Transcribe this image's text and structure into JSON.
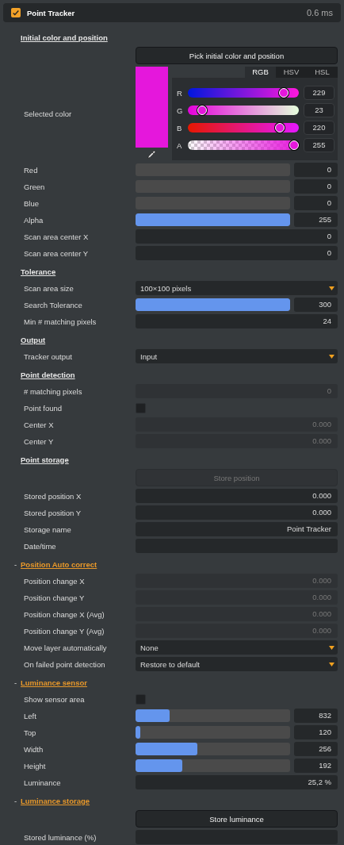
{
  "header": {
    "checked": true,
    "title": "Point Tracker",
    "time": "0.6 ms"
  },
  "sections": [
    {
      "title": "Initial color and position",
      "rows": [
        {
          "kind": "button",
          "text": "Pick initial color and position",
          "disabled": false
        },
        {
          "kind": "color",
          "label": "Selected color",
          "color": "#e517dc",
          "tabs": [
            {
              "label": "RGB",
              "selected": true
            },
            {
              "label": "HSV",
              "selected": false
            },
            {
              "label": "HSL",
              "selected": false
            }
          ],
          "channels": [
            {
              "name": "R",
              "level": 0.898,
              "value": "229"
            },
            {
              "name": "G",
              "level": 0.09,
              "value": "23"
            },
            {
              "name": "B",
              "level": 0.863,
              "value": "220"
            },
            {
              "name": "A",
              "level": 1,
              "value": "255"
            }
          ]
        },
        {
          "kind": "slider",
          "label": "Red",
          "level": 0,
          "value": "0"
        },
        {
          "kind": "slider",
          "label": "Green",
          "level": 0,
          "value": "0"
        },
        {
          "kind": "slider",
          "label": "Blue",
          "level": 0,
          "value": "0"
        },
        {
          "kind": "slider",
          "label": "Alpha",
          "level": 1,
          "value": "255"
        },
        {
          "kind": "number",
          "label": "Scan area center X",
          "value": "0",
          "disabled": false
        },
        {
          "kind": "number",
          "label": "Scan area center Y",
          "value": "0",
          "disabled": false
        }
      ]
    },
    {
      "title": "Tolerance",
      "rows": [
        {
          "kind": "dropdown",
          "label": "Scan area size",
          "value": "100×100 pixels"
        },
        {
          "kind": "slider",
          "label": "Search Tolerance",
          "level": 1,
          "value": "300"
        },
        {
          "kind": "number",
          "label": "Min # matching pixels",
          "value": "24",
          "disabled": false
        }
      ]
    },
    {
      "title": "Output",
      "rows": [
        {
          "kind": "dropdown",
          "label": "Tracker output",
          "value": "Input"
        }
      ]
    },
    {
      "title": "Point detection",
      "rows": [
        {
          "kind": "number",
          "label": "# matching pixels",
          "value": "0",
          "disabled": true
        },
        {
          "kind": "checkbox",
          "label": "Point found",
          "checked": false
        },
        {
          "kind": "number",
          "label": "Center X",
          "value": "0.000",
          "disabled": true
        },
        {
          "kind": "number",
          "label": "Center Y",
          "value": "0.000",
          "disabled": true
        }
      ]
    },
    {
      "title": "Point storage",
      "rows": [
        {
          "kind": "button",
          "text": "Store position",
          "disabled": true
        },
        {
          "kind": "number",
          "label": "Stored position X",
          "value": "0.000",
          "disabled": false
        },
        {
          "kind": "number",
          "label": "Stored position Y",
          "value": "0.000",
          "disabled": false
        },
        {
          "kind": "number",
          "label": "Storage name",
          "value": "Point Tracker",
          "disabled": false
        },
        {
          "kind": "number",
          "label": "Date/time"
        }
      ]
    },
    {
      "title": "Position Auto correct",
      "toggle": "-",
      "rows": [
        {
          "kind": "number",
          "label": "Position change X",
          "value": "0.000",
          "disabled": true
        },
        {
          "kind": "number",
          "label": "Position change Y",
          "value": "0.000",
          "disabled": true
        },
        {
          "kind": "number",
          "label": "Position change X (Avg)",
          "value": "0.000",
          "disabled": true
        },
        {
          "kind": "number",
          "label": "Position change Y (Avg)",
          "value": "0.000",
          "disabled": true
        },
        {
          "kind": "dropdown",
          "label": "Move layer automatically",
          "value": "None"
        },
        {
          "kind": "dropdown",
          "label": "On failed point detection",
          "value": "Restore to default"
        }
      ]
    },
    {
      "title": "Luminance sensor",
      "toggle": "-",
      "rows": [
        {
          "kind": "checkbox",
          "label": "Show sensor area",
          "checked": false
        },
        {
          "kind": "slider",
          "label": "Left",
          "level": 0.22,
          "value": "832"
        },
        {
          "kind": "slider",
          "label": "Top",
          "level": 0.03,
          "value": "120"
        },
        {
          "kind": "slider",
          "label": "Width",
          "level": 0.4,
          "value": "256"
        },
        {
          "kind": "slider",
          "label": "Height",
          "level": 0.3,
          "value": "192"
        },
        {
          "kind": "number",
          "label": "Luminance",
          "value": "25,2 %",
          "disabled": false
        }
      ]
    },
    {
      "title": "Luminance storage",
      "toggle": "-",
      "rows": [
        {
          "kind": "button",
          "text": "Store luminance",
          "disabled": false
        },
        {
          "kind": "number",
          "label": "Stored luminance (%)"
        }
      ]
    }
  ]
}
